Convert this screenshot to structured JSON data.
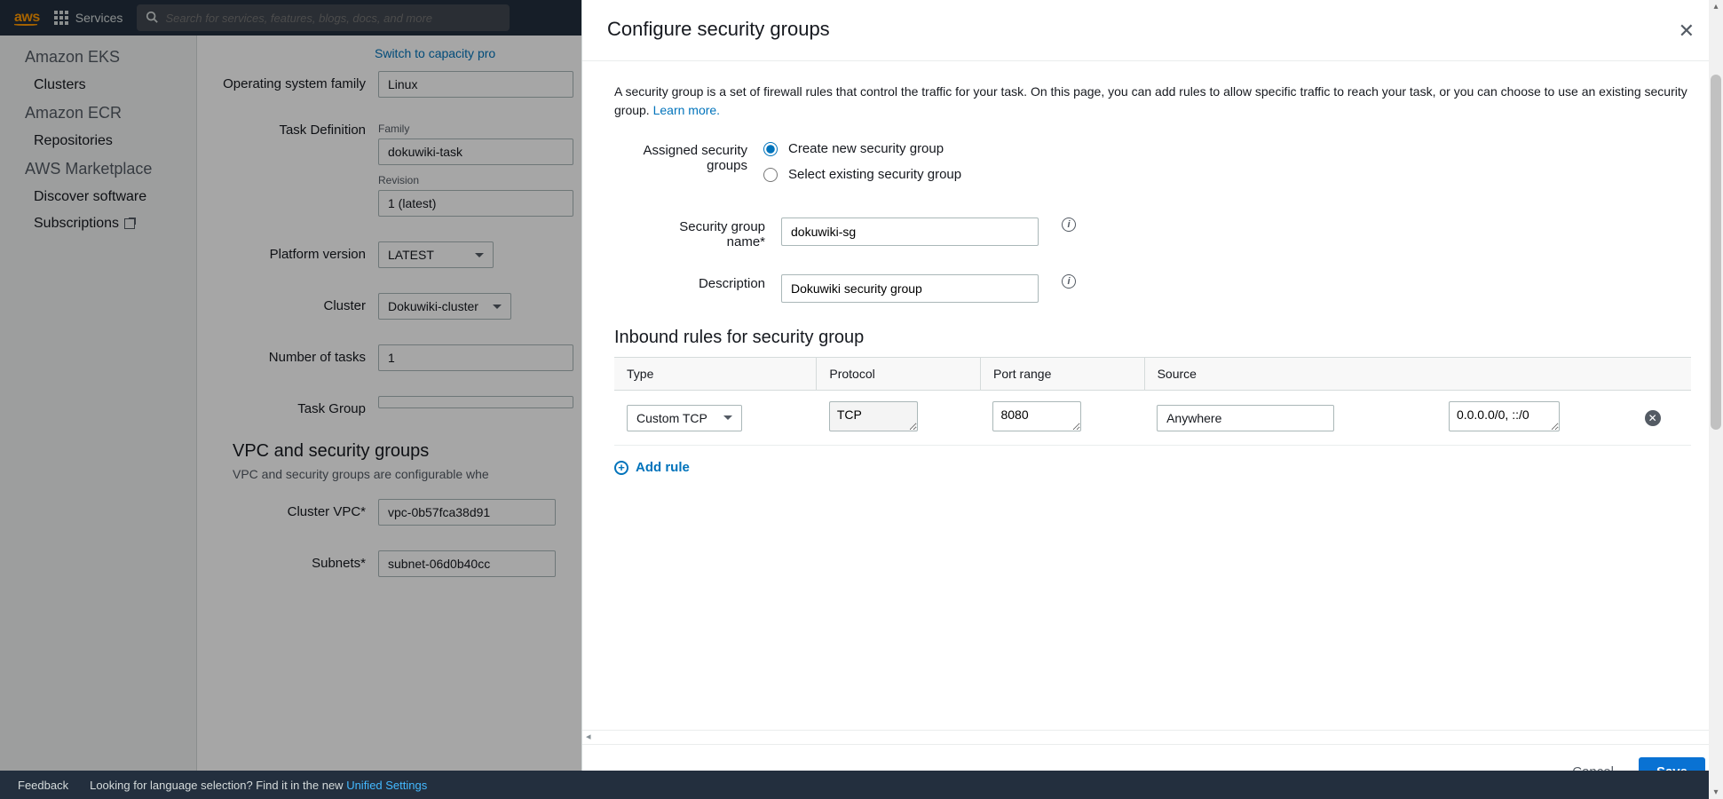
{
  "nav": {
    "logo": "aws",
    "services": "Services",
    "search_placeholder": "Search for services, features, blogs, docs, and more"
  },
  "sidebar": {
    "eks_title": "Amazon EKS",
    "eks_clusters": "Clusters",
    "ecr_title": "Amazon ECR",
    "ecr_repos": "Repositories",
    "marketplace_title": "AWS Marketplace",
    "mp_discover": "Discover software",
    "mp_subs": "Subscriptions"
  },
  "bg": {
    "switch_link": "Switch to capacity pro",
    "osfamily_label": "Operating system family",
    "osfamily_value": "Linux",
    "taskdef_label": "Task Definition",
    "family_sublabel": "Family",
    "family_value": "dokuwiki-task",
    "revision_sublabel": "Revision",
    "revision_value": "1 (latest)",
    "platformver_label": "Platform version",
    "platformver_value": "LATEST",
    "cluster_label": "Cluster",
    "cluster_value": "Dokuwiki-cluster",
    "ntasks_label": "Number of tasks",
    "ntasks_value": "1",
    "taskgroup_label": "Task Group",
    "vpc_heading": "VPC and security groups",
    "vpc_sub": "VPC and security groups are configurable whe",
    "clustervpc_label": "Cluster VPC*",
    "clustervpc_value": "vpc-0b57fca38d91",
    "subnets_label": "Subnets*",
    "subnets_value": "subnet-06d0b40cc"
  },
  "modal": {
    "title": "Configure security groups",
    "intro_text": "A security group is a set of firewall rules that control the traffic for your task. On this page, you can add rules to allow specific traffic to reach your task, or you can choose to use an existing security group. ",
    "learn_more": "Learn more.",
    "assigned_label": "Assigned security groups",
    "radio_create": "Create new security group",
    "radio_select": "Select existing security group",
    "sgname_label": "Security group name*",
    "sgname_value": "dokuwiki-sg",
    "desc_label": "Description",
    "desc_value": "Dokuwiki security group",
    "inbound_title": "Inbound rules for security group",
    "th_type": "Type",
    "th_protocol": "Protocol",
    "th_portrange": "Port range",
    "th_source": "Source",
    "rule": {
      "type": "Custom TCP",
      "protocol": "TCP",
      "port": "8080",
      "source_select": "Anywhere",
      "source_cidr": "0.0.0.0/0, ::/0"
    },
    "add_rule": "Add rule",
    "cancel": "Cancel",
    "save": "Save"
  },
  "feedback": {
    "feedback": "Feedback",
    "lang_prompt": "Looking for language selection? Find it in the new ",
    "unified": "Unified Settings"
  }
}
